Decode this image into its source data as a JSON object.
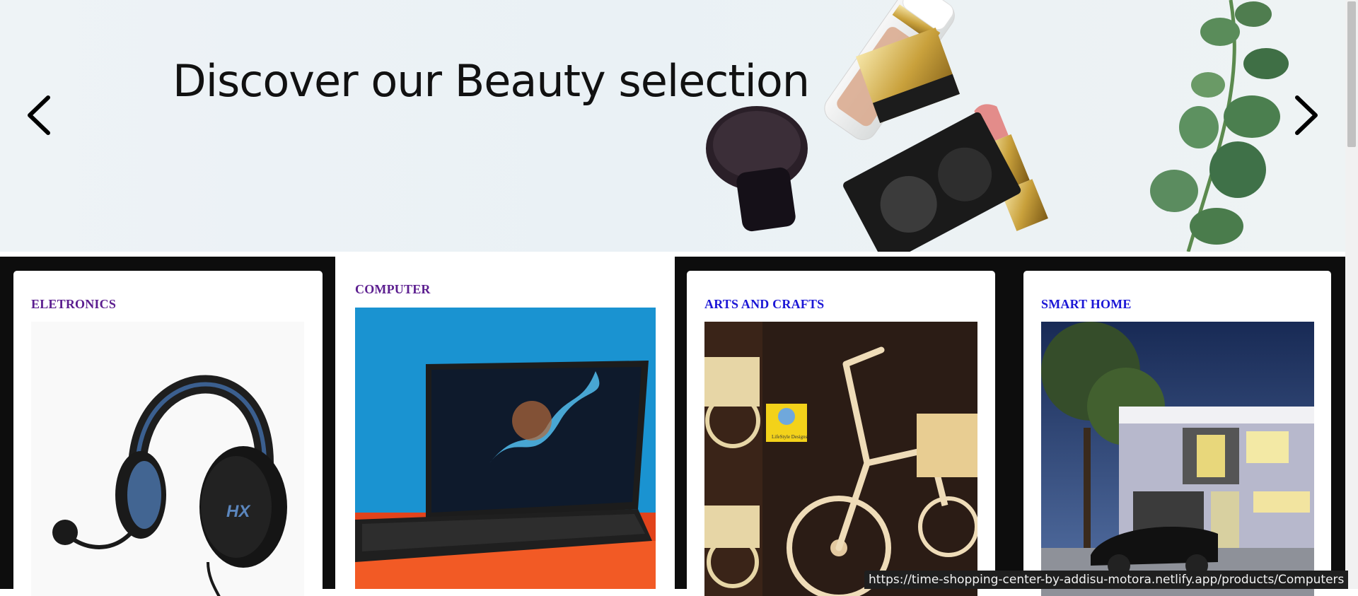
{
  "hero": {
    "title": "Discover our Beauty selection",
    "prev_icon": "chevron-left-icon",
    "next_icon": "chevron-right-icon"
  },
  "categories": [
    {
      "title": "ELETRONICS",
      "image": "headphones-image",
      "title_color": "#5b1d8f"
    },
    {
      "title": "COMPUTER",
      "image": "laptop-image",
      "title_color": "#5b1d8f"
    },
    {
      "title": "ARTS AND CRAFTS",
      "image": "craft-bicycle-image",
      "title_color": "#1b16d6"
    },
    {
      "title": "SMART HOME",
      "image": "smart-house-image",
      "title_color": "#1b16d6"
    }
  ],
  "status_bar": {
    "url": "https://time-shopping-center-by-addisu-motora.netlify.app/products/Computers"
  },
  "colors": {
    "hero_background": "#eef3f6",
    "category_row_background": "#0d0d0d",
    "title_purple": "#5b1d8f",
    "title_blue": "#1b16d6"
  }
}
